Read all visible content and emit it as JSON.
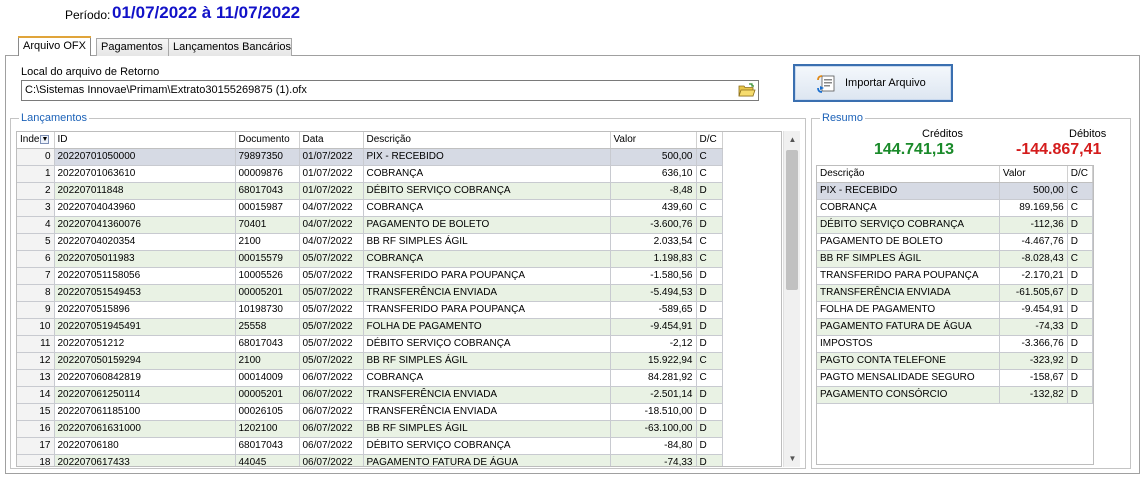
{
  "header": {
    "periodo_label": "Período:",
    "periodo_value": "01/07/2022 à 11/07/2022"
  },
  "tabs": [
    {
      "label": "Arquivo OFX",
      "active": true
    },
    {
      "label": "Pagamentos",
      "active": false
    },
    {
      "label": "Lançamentos Bancários",
      "active": false
    }
  ],
  "file": {
    "label": "Local do arquivo de Retorno",
    "value": "C:\\Sistemas Innovae\\Primam\\Extrato30155269875 (1).ofx",
    "browse_icon": "folder-open-icon"
  },
  "import_button": {
    "label": "Importar Arquivo",
    "icon": "import-file-icon"
  },
  "lancamentos": {
    "title": "Lançamentos",
    "columns": [
      "Inde",
      "ID",
      "Documento",
      "Data",
      "Descrição",
      "Valor",
      "D/C"
    ],
    "rows": [
      [
        "0",
        "20220701050000",
        "79897350",
        "01/07/2022",
        "PIX - RECEBIDO",
        "500,00",
        "C"
      ],
      [
        "1",
        "20220701063610",
        "00009876",
        "01/07/2022",
        "COBRANÇA",
        "636,10",
        "C"
      ],
      [
        "2",
        "202207011848",
        "68017043",
        "01/07/2022",
        "DÉBITO SERVIÇO COBRANÇA",
        "-8,48",
        "D"
      ],
      [
        "3",
        "20220704043960",
        "00015987",
        "04/07/2022",
        "COBRANÇA",
        "439,60",
        "C"
      ],
      [
        "4",
        "202207041360076",
        "70401",
        "04/07/2022",
        "PAGAMENTO DE BOLETO",
        "-3.600,76",
        "D"
      ],
      [
        "5",
        "20220704020354",
        "2100",
        "04/07/2022",
        "BB RF SIMPLES ÁGIL",
        "2.033,54",
        "C"
      ],
      [
        "6",
        "20220705011983",
        "00015579",
        "05/07/2022",
        "COBRANÇA",
        "1.198,83",
        "C"
      ],
      [
        "7",
        "202207051158056",
        "10005526",
        "05/07/2022",
        "TRANSFERIDO PARA POUPANÇA",
        "-1.580,56",
        "D"
      ],
      [
        "8",
        "202207051549453",
        "00005201",
        "05/07/2022",
        "TRANSFERÊNCIA ENVIADA",
        "-5.494,53",
        "D"
      ],
      [
        "9",
        "2022070515896",
        "10198730",
        "05/07/2022",
        "TRANSFERIDO PARA POUPANÇA",
        "-589,65",
        "D"
      ],
      [
        "10",
        "202207051945491",
        "25558",
        "05/07/2022",
        "FOLHA DE PAGAMENTO",
        "-9.454,91",
        "D"
      ],
      [
        "11",
        "202207051212",
        "68017043",
        "05/07/2022",
        "DÉBITO SERVIÇO COBRANÇA",
        "-2,12",
        "D"
      ],
      [
        "12",
        "202207050159294",
        "2100",
        "05/07/2022",
        "BB RF SIMPLES ÁGIL",
        "15.922,94",
        "C"
      ],
      [
        "13",
        "202207060842819",
        "00014009",
        "06/07/2022",
        "COBRANÇA",
        "84.281,92",
        "C"
      ],
      [
        "14",
        "202207061250114",
        "00005201",
        "06/07/2022",
        "TRANSFERÊNCIA ENVIADA",
        "-2.501,14",
        "D"
      ],
      [
        "15",
        "202207061185100",
        "00026105",
        "06/07/2022",
        "TRANSFERÊNCIA ENVIADA",
        "-18.510,00",
        "D"
      ],
      [
        "16",
        "202207061631000",
        "1202100",
        "06/07/2022",
        "BB RF SIMPLES ÁGIL",
        "-63.100,00",
        "D"
      ],
      [
        "17",
        "20220706180",
        "68017043",
        "06/07/2022",
        "DÉBITO SERVIÇO COBRANÇA",
        "-84,80",
        "D"
      ],
      [
        "18",
        "2022070617433",
        "44045",
        "06/07/2022",
        "PAGAMENTO FATURA DE ÁGUA",
        "-74,33",
        "D"
      ]
    ]
  },
  "resumo": {
    "title": "Resumo",
    "creditos_label": "Créditos",
    "creditos_value": "144.741,13",
    "creditos_color": "#1a8a2a",
    "debitos_label": "Débitos",
    "debitos_value": "-144.867,41",
    "debitos_color": "#d41c1c",
    "columns": [
      "Descrição",
      "Valor",
      "D/C"
    ],
    "rows": [
      [
        "PIX - RECEBIDO",
        "500,00",
        "C"
      ],
      [
        "COBRANÇA",
        "89.169,56",
        "C"
      ],
      [
        "DÉBITO SERVIÇO COBRANÇA",
        "-112,36",
        "D"
      ],
      [
        "PAGAMENTO DE BOLETO",
        "-4.467,76",
        "D"
      ],
      [
        "BB RF SIMPLES ÁGIL",
        "-8.028,43",
        "C"
      ],
      [
        "TRANSFERIDO PARA POUPANÇA",
        "-2.170,21",
        "D"
      ],
      [
        "TRANSFERÊNCIA ENVIADA",
        "-61.505,67",
        "D"
      ],
      [
        "FOLHA DE PAGAMENTO",
        "-9.454,91",
        "D"
      ],
      [
        "PAGAMENTO FATURA DE ÁGUA",
        "-74,33",
        "D"
      ],
      [
        "IMPOSTOS",
        "-3.366,76",
        "D"
      ],
      [
        "PAGTO CONTA TELEFONE",
        "-323,92",
        "D"
      ],
      [
        "PAGTO MENSALIDADE SEGURO",
        "-158,67",
        "D"
      ],
      [
        "PAGAMENTO CONSÓRCIO",
        "-132,82",
        "D"
      ]
    ]
  }
}
